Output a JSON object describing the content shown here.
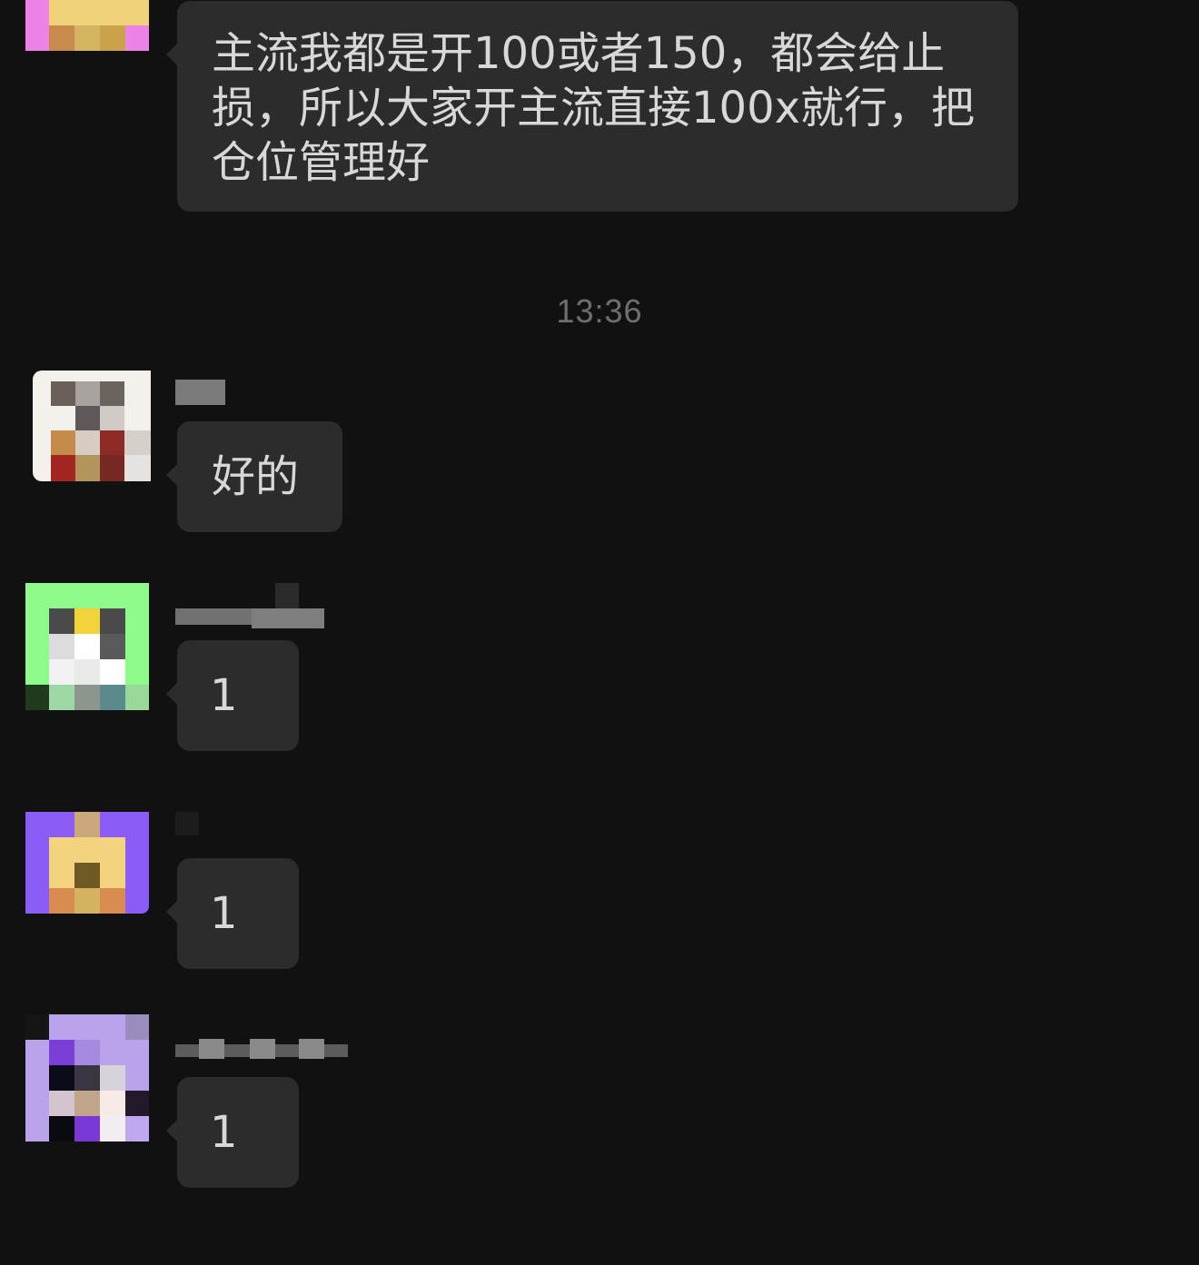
{
  "chat": {
    "divider_time": "13:36",
    "messages": [
      {
        "id": "m1",
        "avatar_icon": "pixelated-avatar-pink",
        "text": "主流我都是开100或者150，都会给止损，所以大家开主流直接100x就行，把仓位管理好"
      },
      {
        "id": "m2",
        "avatar_icon": "pixelated-avatar-white",
        "text": "好的"
      },
      {
        "id": "m3",
        "avatar_icon": "pixelated-avatar-green",
        "text": "1"
      },
      {
        "id": "m4",
        "avatar_icon": "pixelated-avatar-purple",
        "text": "1"
      },
      {
        "id": "m5",
        "avatar_icon": "pixelated-avatar-lavender",
        "text": "1"
      }
    ]
  },
  "colors": {
    "background": "#111112",
    "bubble": "#2c2c2c",
    "text": "#d8d8d8",
    "timestamp": "#6f6f6f"
  }
}
